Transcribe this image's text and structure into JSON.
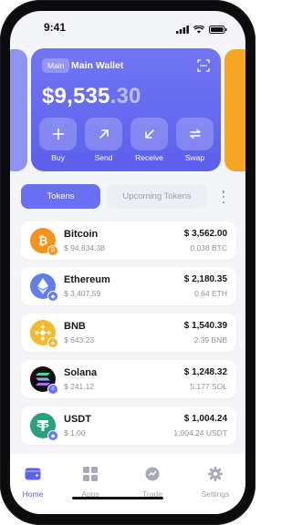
{
  "status": {
    "time": "9:41"
  },
  "wallet": {
    "chip": "Main",
    "name": "Main Wallet",
    "balance_main": "$9,535",
    "balance_decimal": ".30",
    "actions": [
      {
        "label": "Buy",
        "icon": "plus-icon"
      },
      {
        "label": "Send",
        "icon": "arrow-up-right-icon"
      },
      {
        "label": "Receive",
        "icon": "arrow-down-left-icon"
      },
      {
        "label": "Swap",
        "icon": "swap-icon"
      }
    ]
  },
  "tabs": {
    "active": "Tokens",
    "inactive": "Upcoming Tokens"
  },
  "tokens": [
    {
      "name": "Bitcoin",
      "price": "$ 94,834.38",
      "value": "$ 3,562.00",
      "amount": "0.038 BTC",
      "color": "#f7931a"
    },
    {
      "name": "Ethereum",
      "price": "$ 3,407.59",
      "value": "$ 2,180.35",
      "amount": "0.64 ETH",
      "color": "#627eea"
    },
    {
      "name": "BNB",
      "price": "$ 643.23",
      "value": "$ 1,540.39",
      "amount": "2.39 BNB",
      "color": "#f3ba2f"
    },
    {
      "name": "Solana",
      "price": "$ 241.12",
      "value": "$ 1,248.32",
      "amount": "5.177 SOL",
      "color": "#0f0f14"
    },
    {
      "name": "USDT",
      "price": "$ 1.00",
      "value": "$ 1,004.24",
      "amount": "1,004.24 USDT",
      "color": "#26a17b"
    }
  ],
  "nav": [
    {
      "label": "Home",
      "icon": "wallet-icon",
      "active": true
    },
    {
      "label": "Apps",
      "icon": "apps-grid-icon",
      "active": false
    },
    {
      "label": "Trade",
      "icon": "trade-icon",
      "active": false
    },
    {
      "label": "Settings",
      "icon": "gear-icon",
      "active": false
    }
  ],
  "colors": {
    "accent": "#5b60ee",
    "card": "#6a70f3",
    "peek_right": "#f5a623"
  }
}
